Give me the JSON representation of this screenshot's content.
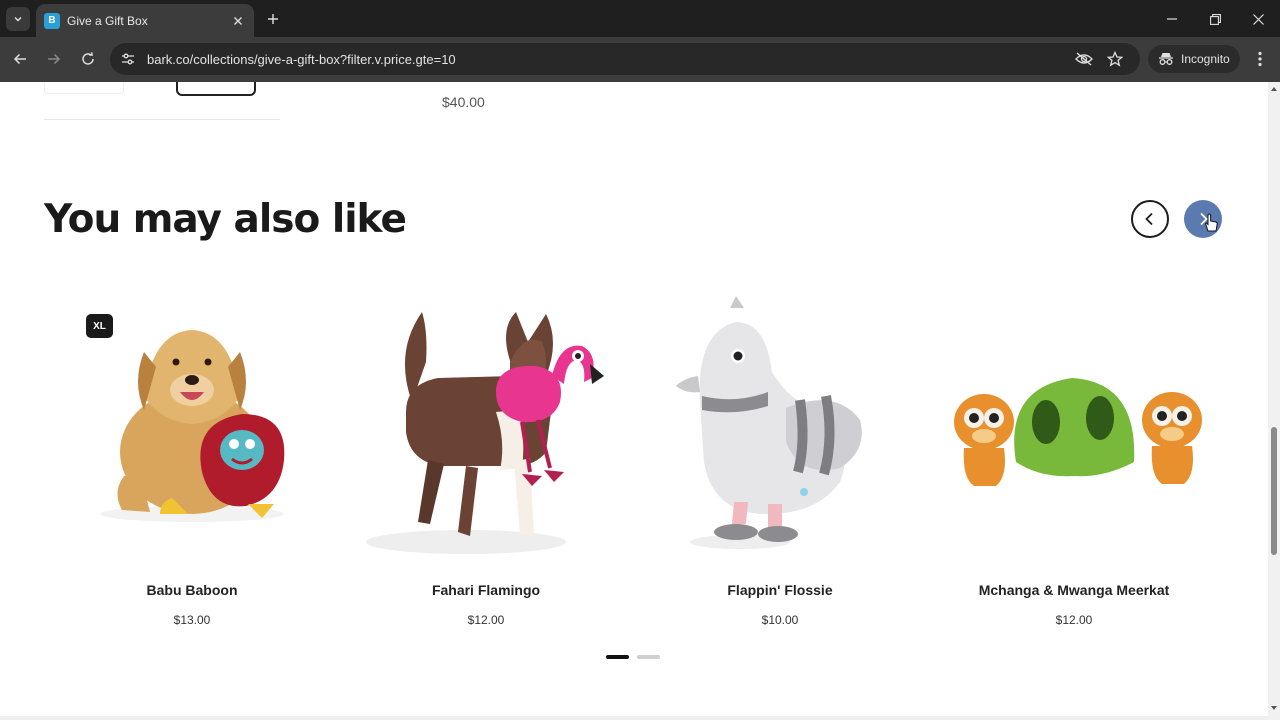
{
  "browser": {
    "tab_title": "Give a Gift Box",
    "url": "bark.co/collections/give-a-gift-box?filter.v.price.gte=10",
    "incognito_label": "Incognito",
    "favicon_letter": "B"
  },
  "previous_section": {
    "price": "$40.00"
  },
  "section": {
    "title": "You may also like",
    "prev_icon": "chevron-left-icon",
    "next_icon": "chevron-right-icon"
  },
  "products": [
    {
      "name": "Babu Baboon",
      "price": "$13.00",
      "badge": "XL"
    },
    {
      "name": "Fahari Flamingo",
      "price": "$12.00"
    },
    {
      "name": "Flappin' Flossie",
      "price": "$10.00"
    },
    {
      "name": "Mchanga & Mwanga Meerkat",
      "price": "$12.00"
    }
  ],
  "carousel": {
    "pages": 2,
    "active_page": 1
  },
  "colors": {
    "accent": "#5b7bb0",
    "text": "#1a1a1a",
    "chrome": "#3c3c3c"
  }
}
